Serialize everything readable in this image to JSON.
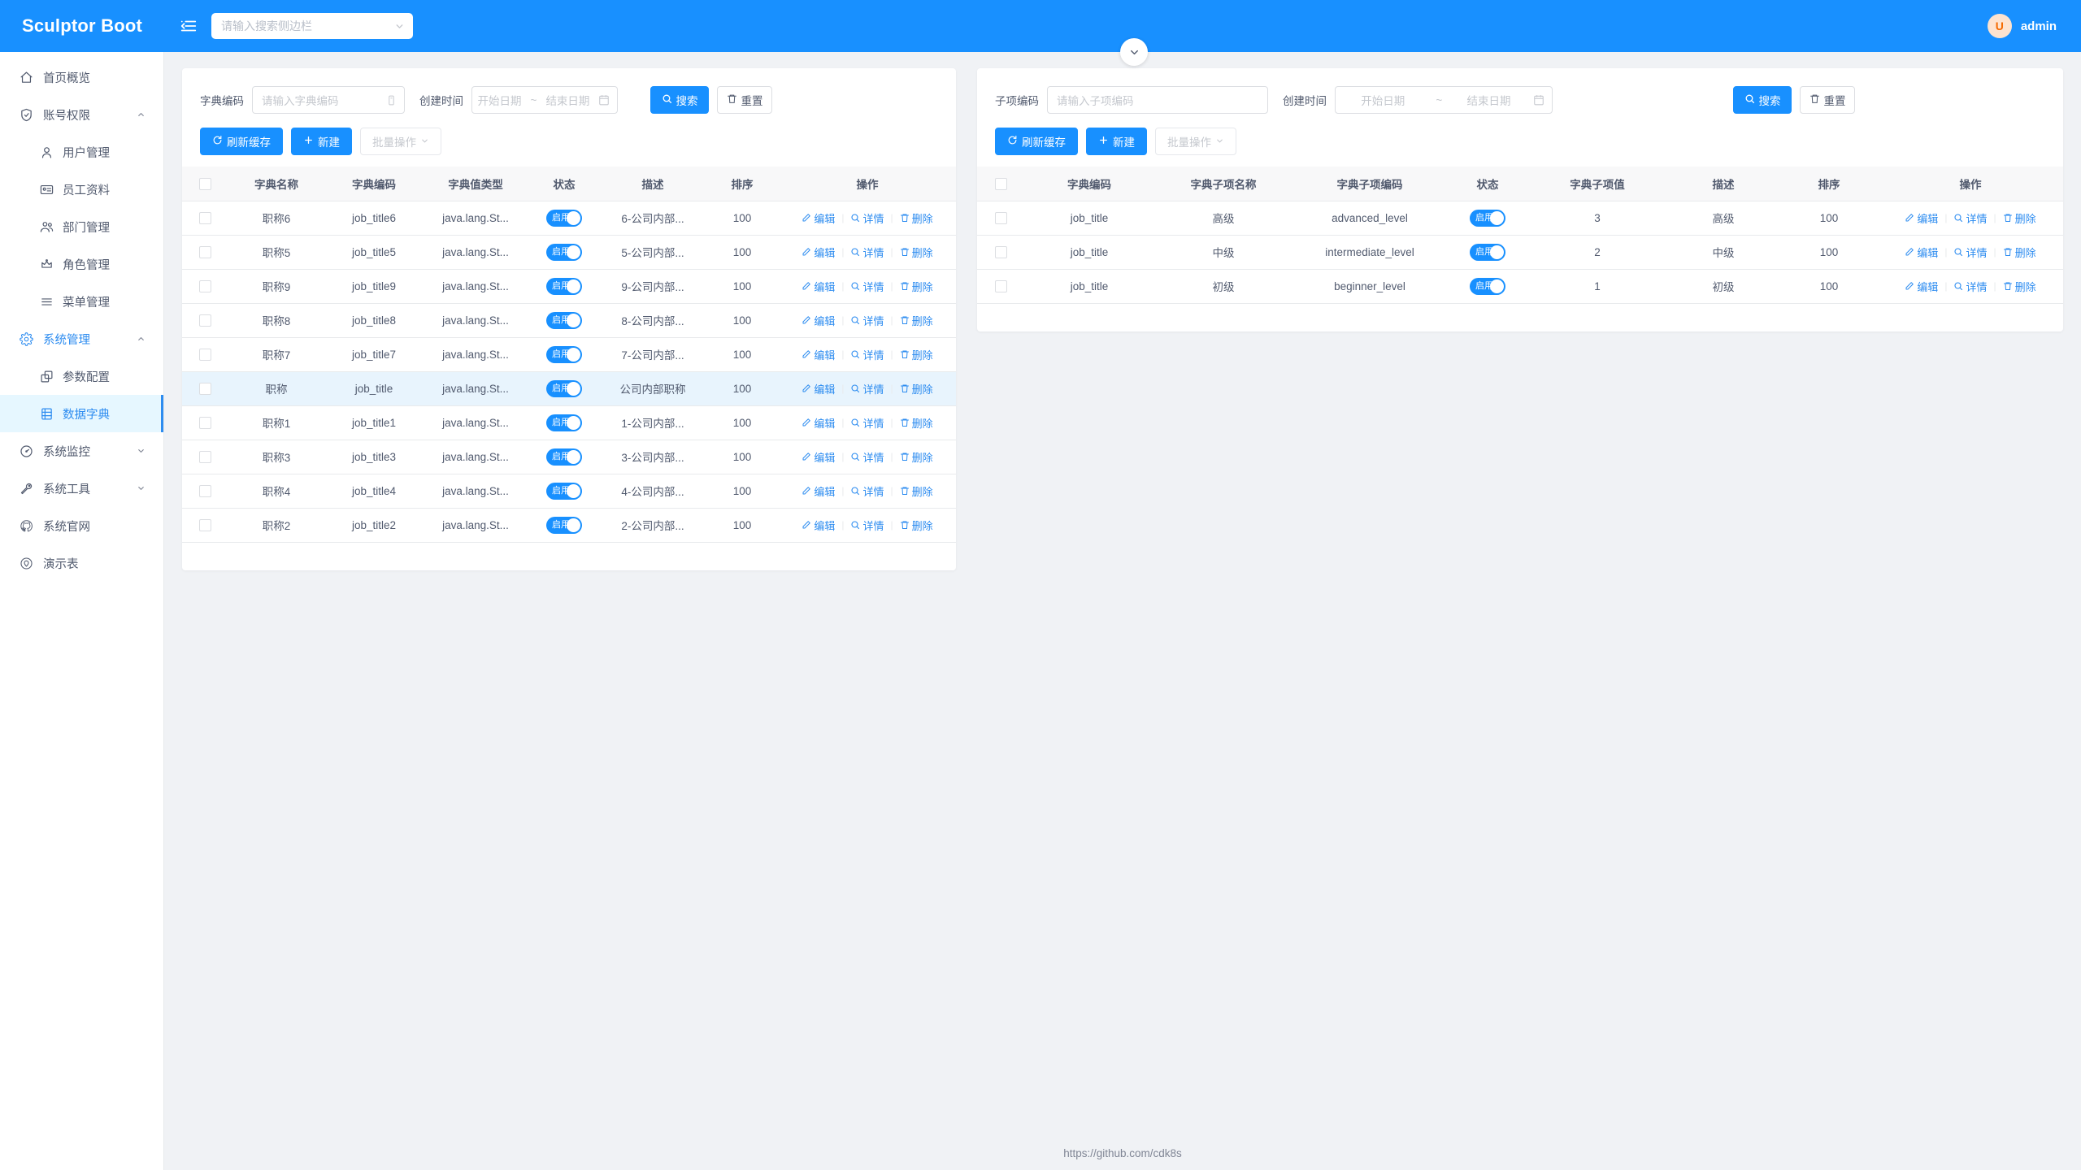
{
  "brand": {
    "title": "Sculptor Boot"
  },
  "header": {
    "hamburger_icon": "menu-fold-icon",
    "search": {
      "placeholder": "请输入搜索侧边栏",
      "value": "",
      "dropdown_icon": "chevron-down-icon"
    },
    "user": {
      "avatar_letter": "U",
      "name": "admin"
    }
  },
  "sidebar": {
    "items": [
      {
        "label": "首页概览",
        "icon": "home-icon",
        "level": 0,
        "state": "normal",
        "caret": ""
      },
      {
        "label": "账号权限",
        "icon": "shield-check-icon",
        "level": 0,
        "state": "normal",
        "caret": "up"
      },
      {
        "label": "用户管理",
        "icon": "user-icon",
        "level": 1,
        "state": "normal",
        "caret": ""
      },
      {
        "label": "员工资料",
        "icon": "id-card-icon",
        "level": 1,
        "state": "normal",
        "caret": ""
      },
      {
        "label": "部门管理",
        "icon": "users-icon",
        "level": 1,
        "state": "normal",
        "caret": ""
      },
      {
        "label": "角色管理",
        "icon": "crown-icon",
        "level": 1,
        "state": "normal",
        "caret": ""
      },
      {
        "label": "菜单管理",
        "icon": "list-icon",
        "level": 1,
        "state": "normal",
        "caret": ""
      },
      {
        "label": "系统管理",
        "icon": "gear-icon",
        "level": 0,
        "state": "active-parent",
        "caret": "up"
      },
      {
        "label": "参数配置",
        "icon": "copy-icon",
        "level": 1,
        "state": "normal",
        "caret": ""
      },
      {
        "label": "数据字典",
        "icon": "book-icon",
        "level": 1,
        "state": "active",
        "caret": ""
      },
      {
        "label": "系统监控",
        "icon": "dashboard-icon",
        "level": 0,
        "state": "normal",
        "caret": "down"
      },
      {
        "label": "系统工具",
        "icon": "wrench-icon",
        "level": 0,
        "state": "normal",
        "caret": "down"
      },
      {
        "label": "系统官网",
        "icon": "github-icon",
        "level": 0,
        "state": "normal",
        "caret": ""
      },
      {
        "label": "演示表",
        "icon": "target-icon",
        "level": 0,
        "state": "normal",
        "caret": ""
      }
    ]
  },
  "collapse_toggle": {
    "icon": "chevron-down-icon"
  },
  "left_panel": {
    "filter": {
      "code_label": "字典编码",
      "code_placeholder": "请输入字典编码",
      "code_value": "",
      "code_suffix_icon": "input-suffix-icon",
      "time_label": "创建时间",
      "start_placeholder": "开始日期",
      "separator": "~",
      "end_placeholder": "结束日期",
      "calendar_icon": "calendar-icon",
      "search_label": "搜索",
      "search_icon": "search-icon",
      "reset_label": "重置",
      "reset_icon": "trash-icon"
    },
    "actions": {
      "refresh_label": "刷新缓存",
      "refresh_icon": "refresh-icon",
      "create_label": "新建",
      "create_icon": "plus-icon",
      "batch_label": "批量操作",
      "batch_icon": "chevron-down-icon"
    },
    "table": {
      "columns": [
        "",
        "字典名称",
        "字典编码",
        "字典值类型",
        "状态",
        "描述",
        "排序",
        "操作"
      ],
      "rows": [
        {
          "name": "职称6",
          "code": "job_title6",
          "type": "java.lang.St...",
          "status": "启用",
          "desc": "6-公司内部...",
          "sort": "100",
          "selected": false
        },
        {
          "name": "职称5",
          "code": "job_title5",
          "type": "java.lang.St...",
          "status": "启用",
          "desc": "5-公司内部...",
          "sort": "100",
          "selected": false
        },
        {
          "name": "职称9",
          "code": "job_title9",
          "type": "java.lang.St...",
          "status": "启用",
          "desc": "9-公司内部...",
          "sort": "100",
          "selected": false
        },
        {
          "name": "职称8",
          "code": "job_title8",
          "type": "java.lang.St...",
          "status": "启用",
          "desc": "8-公司内部...",
          "sort": "100",
          "selected": false
        },
        {
          "name": "职称7",
          "code": "job_title7",
          "type": "java.lang.St...",
          "status": "启用",
          "desc": "7-公司内部...",
          "sort": "100",
          "selected": false
        },
        {
          "name": "职称",
          "code": "job_title",
          "type": "java.lang.St...",
          "status": "启用",
          "desc": "公司内部职称",
          "sort": "100",
          "selected": true
        },
        {
          "name": "职称1",
          "code": "job_title1",
          "type": "java.lang.St...",
          "status": "启用",
          "desc": "1-公司内部...",
          "sort": "100",
          "selected": false
        },
        {
          "name": "职称3",
          "code": "job_title3",
          "type": "java.lang.St...",
          "status": "启用",
          "desc": "3-公司内部...",
          "sort": "100",
          "selected": false
        },
        {
          "name": "职称4",
          "code": "job_title4",
          "type": "java.lang.St...",
          "status": "启用",
          "desc": "4-公司内部...",
          "sort": "100",
          "selected": false
        },
        {
          "name": "职称2",
          "code": "job_title2",
          "type": "java.lang.St...",
          "status": "启用",
          "desc": "2-公司内部...",
          "sort": "100",
          "selected": false
        }
      ]
    }
  },
  "right_panel": {
    "filter": {
      "code_label": "子项编码",
      "code_placeholder": "请输入子项编码",
      "code_value": "",
      "time_label": "创建时间",
      "start_placeholder": "开始日期",
      "separator": "~",
      "end_placeholder": "结束日期",
      "calendar_icon": "calendar-icon",
      "search_label": "搜索",
      "search_icon": "search-icon",
      "reset_label": "重置",
      "reset_icon": "trash-icon"
    },
    "actions": {
      "refresh_label": "刷新缓存",
      "refresh_icon": "refresh-icon",
      "create_label": "新建",
      "create_icon": "plus-icon",
      "batch_label": "批量操作",
      "batch_icon": "chevron-down-icon"
    },
    "table": {
      "columns": [
        "",
        "字典编码",
        "字典子项名称",
        "字典子项编码",
        "状态",
        "字典子项值",
        "描述",
        "排序",
        "操作"
      ],
      "rows": [
        {
          "code": "job_title",
          "item_name": "高级",
          "item_code": "advanced_level",
          "status": "启用",
          "item_value": "3",
          "desc": "高级",
          "sort": "100"
        },
        {
          "code": "job_title",
          "item_name": "中级",
          "item_code": "intermediate_level",
          "status": "启用",
          "item_value": "2",
          "desc": "中级",
          "sort": "100"
        },
        {
          "code": "job_title",
          "item_name": "初级",
          "item_code": "beginner_level",
          "status": "启用",
          "item_value": "1",
          "desc": "初级",
          "sort": "100"
        }
      ]
    }
  },
  "row_ops": {
    "edit_label": "编辑",
    "edit_icon": "pencil-icon",
    "detail_label": "详情",
    "detail_icon": "search-icon",
    "delete_label": "删除",
    "delete_icon": "trash-icon"
  },
  "footer": {
    "text": "https://github.com/cdk8s"
  },
  "colors": {
    "primary": "#1890ff",
    "link": "#2d8cf0",
    "selected_row": "#e8f4fd",
    "sidebar_active_bg": "#e6f7ff",
    "text": "#515a6e",
    "placeholder": "#c5c8ce",
    "page_bg": "#f0f2f5"
  }
}
